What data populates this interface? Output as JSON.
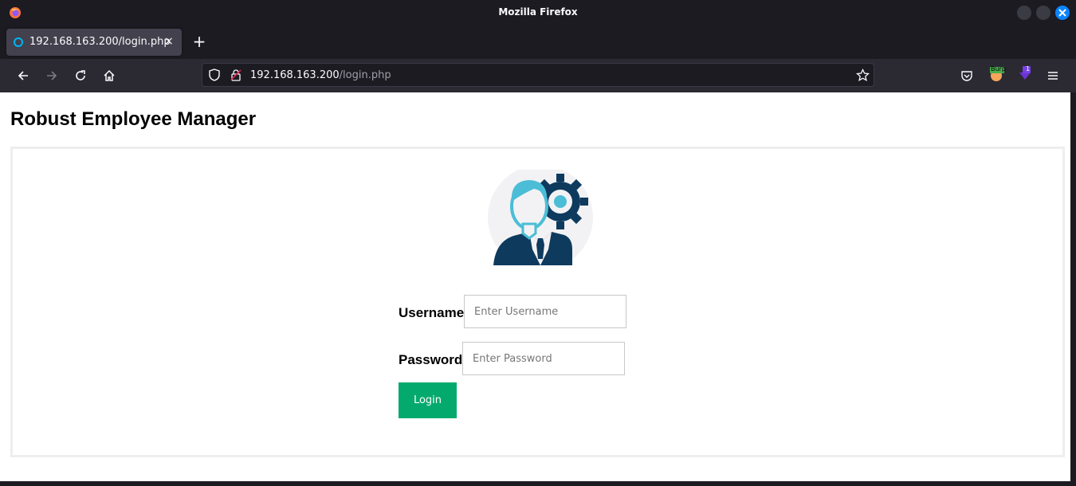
{
  "window": {
    "title": "Mozilla Firefox"
  },
  "tab": {
    "title": "192.168.163.200/login.php",
    "close": "×"
  },
  "url": {
    "host": "192.168.163.200",
    "path": "/login.php"
  },
  "extensions": {
    "burp_label": "Burp",
    "badge_count": "1"
  },
  "page": {
    "title": "Robust Employee Manager",
    "username_label": "Username",
    "username_placeholder": "Enter Username",
    "username_value": "",
    "password_label": "Password",
    "password_placeholder": "Enter Password",
    "password_value": "",
    "login_label": "Login"
  },
  "colors": {
    "accent": "#04aa6d",
    "chrome": "#1c1b22",
    "toolbar": "#2b2a33",
    "avatar_dark": "#0e3a5e",
    "avatar_light": "#4bbdd6"
  }
}
